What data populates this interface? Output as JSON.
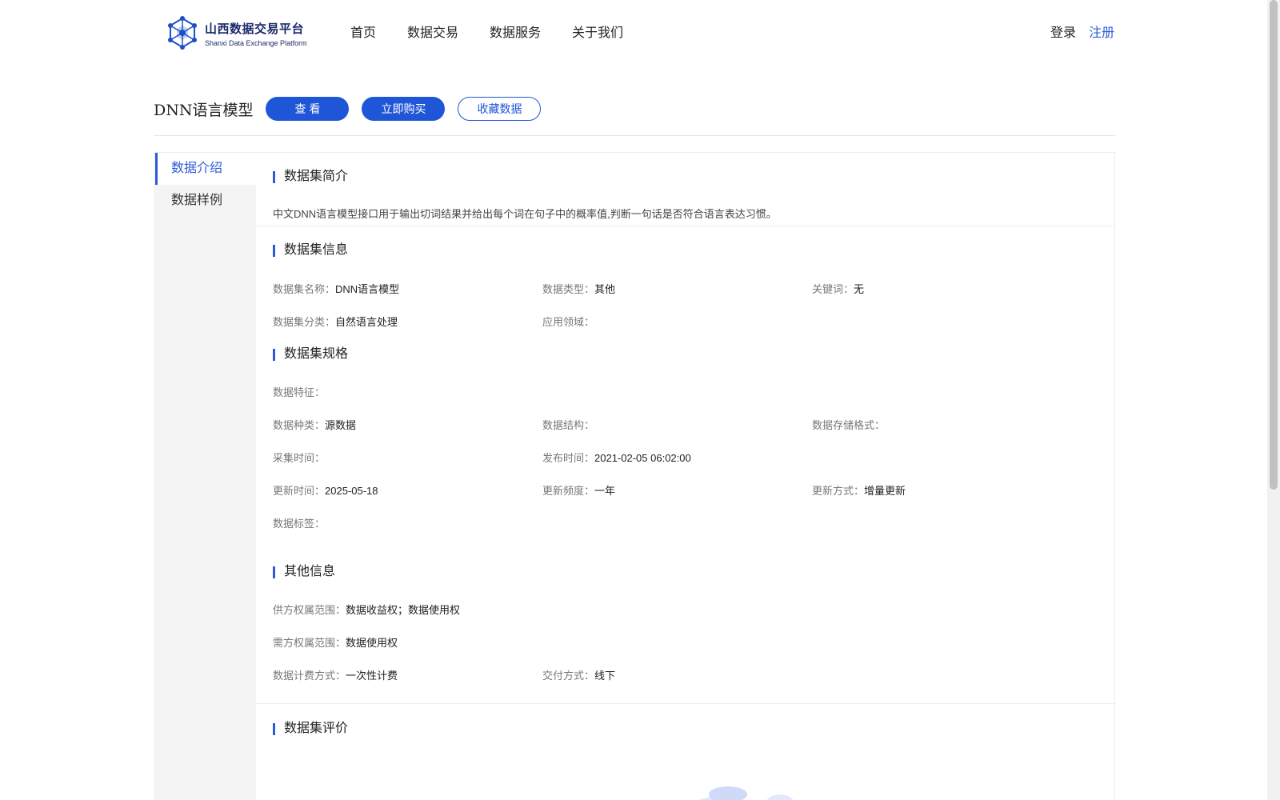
{
  "header": {
    "logo_title": "山西数据交易平台",
    "logo_sub": "Shanxi Data Exchange Platform",
    "nav": [
      "首页",
      "数据交易",
      "数据服务",
      "关于我们"
    ],
    "login": "登录",
    "register": "注册"
  },
  "title_row": {
    "title": "DNN语言模型",
    "view_btn": "查 看",
    "buy_btn": "立即购买",
    "fav_btn": "收藏数据"
  },
  "sidebar": {
    "items": [
      "数据介绍",
      "数据样例"
    ]
  },
  "intro": {
    "heading": "数据集简介",
    "text": "中文DNN语言模型接口用于输出切词结果并给出每个词在句子中的概率值,判断一句话是否符合语言表达习惯。"
  },
  "info": {
    "heading": "数据集信息",
    "name_k": "数据集名称：",
    "name_v": "DNN语言模型",
    "type_k": "数据类型：",
    "type_v": "其他",
    "kw_k": "关键词：",
    "kw_v": "无",
    "cat_k": "数据集分类：",
    "cat_v": "自然语言处理",
    "domain_k": "应用领域："
  },
  "spec": {
    "heading": "数据集规格",
    "feature_k": "数据特征：",
    "kind_k": "数据种类：",
    "kind_v": "源数据",
    "struct_k": "数据结构：",
    "storage_k": "数据存储格式：",
    "collect_k": "采集时间：",
    "publish_k": "发布时间：",
    "publish_v": "2021-02-05 06:02:00",
    "update_k": "更新时间：",
    "update_v": "2025-05-18",
    "freq_k": "更新频度：",
    "freq_v": "一年",
    "mode_k": "更新方式：",
    "mode_v": "增量更新",
    "tag_k": "数据标签："
  },
  "other": {
    "heading": "其他信息",
    "supply_k": "供方权属范围：",
    "supply_v": "数据收益权；数据使用权",
    "demand_k": "需方权属范围：",
    "demand_v": "数据使用权",
    "billing_k": "数据计费方式：",
    "billing_v": "一次性计费",
    "delivery_k": "交付方式：",
    "delivery_v": "线下"
  },
  "review": {
    "heading": "数据集评价"
  },
  "colors": {
    "accent": "#1f56d8",
    "link": "#2d5bd8",
    "sidebar_bg": "#f4f4f4"
  }
}
